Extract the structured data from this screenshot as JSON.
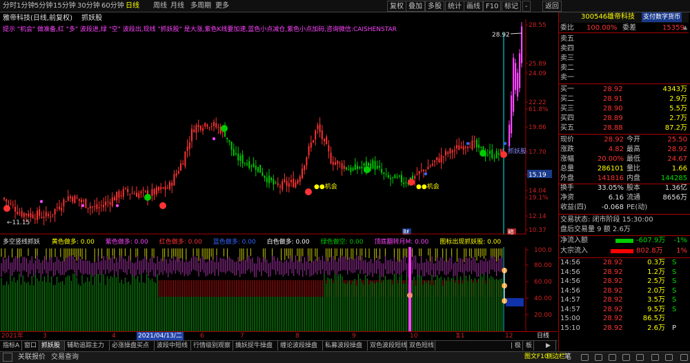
{
  "toolbar": {
    "left": [
      "分时",
      "1分钟",
      "5分钟",
      "15分钟",
      "30分钟",
      "60分钟",
      "日线",
      "周线",
      "月线",
      "多周期",
      "更多"
    ],
    "active": "日线",
    "right": [
      "复权",
      "叠加",
      "多股",
      "统计",
      "画线",
      "F10",
      "标记",
      "-",
      "返回"
    ]
  },
  "chart_header": {
    "title": "雅帝科技(日线,前复权)",
    "formula": "抓妖股",
    "hint": "提示 \"机会\" 做准备,红 \"多\" 波段进,绿 \"空\" 波段出,现线 \"抓妖股\" 是大涨,紫色K线要加速,蓝色小点减仓,紫色小点加码,咨询微信:CAISHENSTAR"
  },
  "price_axis": [
    "28.55",
    "25.89",
    "24.09",
    "22.22",
    "61.8%",
    "19.86",
    "17.70",
    "15.19",
    "14.04",
    "19.1%",
    "12.14",
    "10.37"
  ],
  "price_axis_current": "15.19",
  "annotations": {
    "high": "28.92",
    "low": "11.15",
    "opp1": "●●机会",
    "opp2": "●●机会",
    "label_zhuayao": "抓妖股",
    "cai": "财",
    "gao": "稿"
  },
  "indicator_header": {
    "name": "多空竖线抓妖",
    "items": [
      {
        "text": "黄色做多: 0.00",
        "color": "#ffff00"
      },
      {
        "text": "紫色做多: 0.00",
        "color": "#ff44ff"
      },
      {
        "text": "红色做多: 0.00",
        "color": "#ff3333"
      },
      {
        "text": "蓝色做多: 0.00",
        "color": "#3366ff"
      },
      {
        "text": "白色做多: 0.00",
        "color": "#ffffff"
      },
      {
        "text": "绿色做空: 0.00",
        "color": "#00cc00"
      },
      {
        "text": "顶底翻转月M: 0.00",
        "color": "#ff44ff"
      },
      {
        "text": "图标出现抓妖股: 0.00",
        "color": "#ffff00"
      }
    ]
  },
  "indicator_axis": [
    "100.0",
    "80.00",
    "60.00",
    "40.00",
    "20.00"
  ],
  "date_axis": {
    "labels": [
      "2021年",
      "3",
      "4",
      "2021/04/13/二",
      "6",
      "7",
      "8",
      "9",
      "10",
      "11",
      "12",
      "1"
    ],
    "period": "日线"
  },
  "bottom_tabs": [
    "指标A",
    "窗口",
    "抓妖股",
    "辅助追踪主力",
    "必涨操盘买点",
    "波段中短线",
    "行情级别观察",
    "擒妖捉牛操盘",
    "缠论波段操盘",
    "私募波段操盘",
    "双色波段短线",
    "双色短线"
  ],
  "bottom_tabs_right": [
    "| 极",
    "板"
  ],
  "status_bar": {
    "left": [
      "关联报价",
      "交易查询"
    ],
    "right": [
      "图文F10",
      "侧边栏"
    ],
    "icons": [
      "笔",
      "ban-icon",
      "list-icon",
      "list2-icon",
      "list3-icon",
      "grid-icon",
      "grid2-icon",
      "chart-icon",
      "bell-icon"
    ]
  },
  "quote": {
    "code": "300546",
    "name": "雄帝科技",
    "badge": "支付数字货币",
    "weibi_label": "委比",
    "weibi": "100.00%",
    "weicha_label": "委差",
    "weicha": "15359",
    "sell": [
      {
        "label": "卖五",
        "price": "",
        "vol": ""
      },
      {
        "label": "卖四",
        "price": "",
        "vol": ""
      },
      {
        "label": "卖三",
        "price": "",
        "vol": ""
      },
      {
        "label": "卖二",
        "price": "",
        "vol": ""
      },
      {
        "label": "卖一",
        "price": "",
        "vol": ""
      }
    ],
    "buy": [
      {
        "label": "买一",
        "price": "28.92",
        "vol": "4343万"
      },
      {
        "label": "买二",
        "price": "28.91",
        "vol": "2.9万"
      },
      {
        "label": "买三",
        "price": "28.90",
        "vol": "5.5万"
      },
      {
        "label": "买四",
        "price": "28.89",
        "vol": "2.7万"
      },
      {
        "label": "买五",
        "price": "28.88",
        "vol": "87.2万"
      }
    ],
    "stats": [
      {
        "l1": "现价",
        "v1": "28.92",
        "c1": "#ff3333",
        "l2": "今开",
        "v2": "25.50",
        "c2": "#ff3333"
      },
      {
        "l1": "涨跌",
        "v1": "4.82",
        "c1": "#ff3333",
        "l2": "最高",
        "v2": "28.92",
        "c2": "#ff3333"
      },
      {
        "l1": "涨幅",
        "v1": "20.00%",
        "c1": "#ff3333",
        "l2": "最低",
        "v2": "24.67",
        "c2": "#ff3333"
      },
      {
        "l1": "总量",
        "v1": "286101",
        "c1": "#ffff00",
        "l2": "量比",
        "v2": "1.66",
        "c2": "#ffff00"
      },
      {
        "l1": "外盘",
        "v1": "141816",
        "c1": "#ff3333",
        "l2": "内盘",
        "v2": "144285",
        "c2": "#00dd00"
      },
      {
        "l1": "换手",
        "v1": "33.05%",
        "c1": "#e0e0e0",
        "l2": "股本",
        "v2": "1.36亿",
        "c2": "#e0e0e0"
      },
      {
        "l1": "净资",
        "v1": "6.16",
        "c1": "#e0e0e0",
        "l2": "流通",
        "v2": "8656万",
        "c2": "#e0e0e0"
      },
      {
        "l1": "收益(四)",
        "v1": "-0.068",
        "c1": "#e0e0e0",
        "l2": "PE(动)",
        "v2": "",
        "c2": "#e0e0e0"
      }
    ],
    "trade_status": "交易状态: 闭市阶段 15:30:00",
    "after_hours": "盘后交易量 9  额 2.6万",
    "flows": [
      {
        "label": "净流入额",
        "value": "-607.9万",
        "pct": "-1%",
        "bar": "#00cc00",
        "fill": 0.6
      },
      {
        "label": "大宗流入",
        "value": "802.8万",
        "pct": "1%",
        "bar": "#ff0000",
        "fill": 0.75
      }
    ],
    "ticks": [
      {
        "time": "14:56",
        "price": "28.92",
        "vol": "0.3万",
        "side": "S"
      },
      {
        "time": "14:56",
        "price": "28.92",
        "vol": "1.2万",
        "side": "S"
      },
      {
        "time": "14:56",
        "price": "28.92",
        "vol": "2.5万",
        "side": "S"
      },
      {
        "time": "14:56",
        "price": "28.92",
        "vol": "2.0万",
        "side": "S"
      },
      {
        "time": "14:57",
        "price": "28.92",
        "vol": "3.5万",
        "side": "S"
      },
      {
        "time": "14:57",
        "price": "28.92",
        "vol": "9.5万",
        "side": "S"
      },
      {
        "time": "15:00",
        "price": "28.92",
        "vol": "86.5万",
        "side": ""
      },
      {
        "time": "15:10",
        "price": "28.92",
        "vol": "2.6万",
        "side": "P"
      }
    ]
  },
  "colors": {
    "up": "#ff3333",
    "down": "#00cc00",
    "grid": "#3a0000",
    "axis_red": "#aa0000"
  }
}
